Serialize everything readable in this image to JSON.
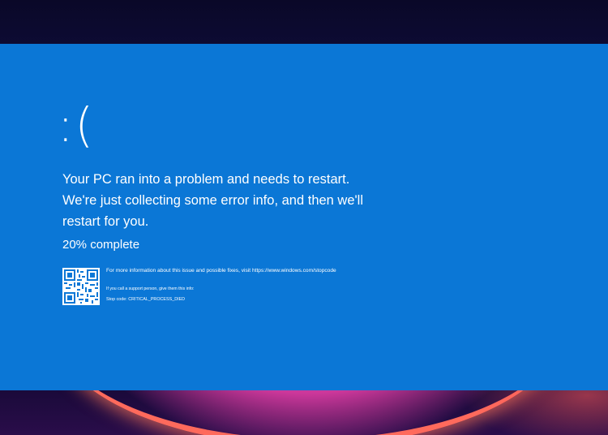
{
  "screen": {
    "sad_face": ":(",
    "message": "Your PC ran into a problem and needs to restart. We're just collecting some error info, and then we'll restart for you.",
    "progress_text": "20% complete",
    "progress_percent": 20,
    "more_info": "For more information about this issue and possible fixes, visit https://www.windows.com/stopcode",
    "support_info": "If you call a support person, give them this info:",
    "stop_code": "Stop code: CRITICAL_PROCESS_DIED"
  },
  "colors": {
    "bsod_background": "#0b77d6",
    "text": "#ffffff",
    "frame_background": "#07061f",
    "glow_accent": "#ff6a5c"
  },
  "icons": {
    "qr": "qr-code-icon"
  }
}
